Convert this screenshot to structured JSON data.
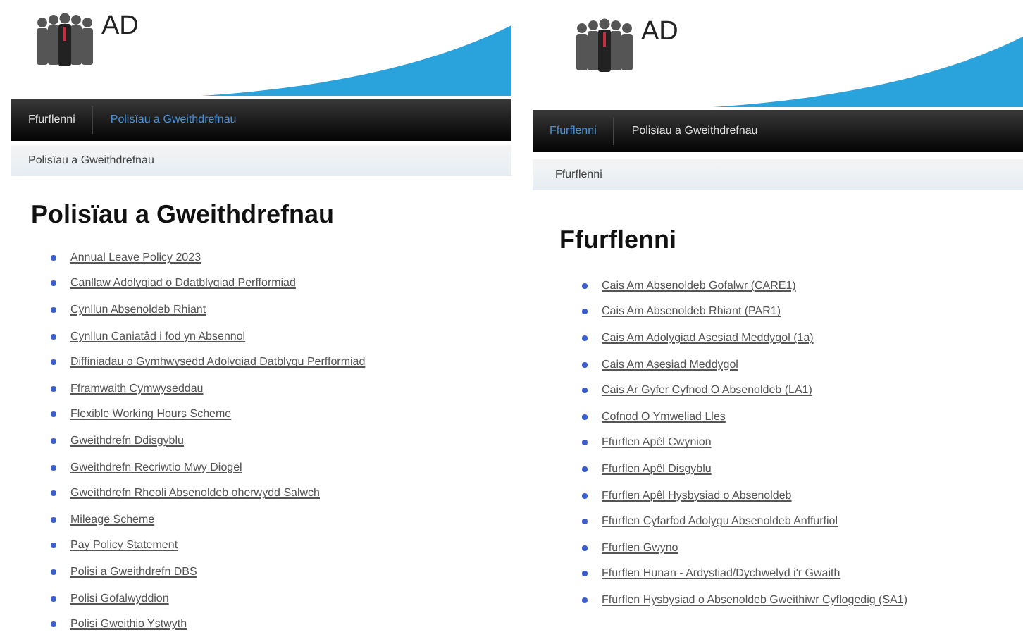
{
  "panels": [
    {
      "logo_text": "AD",
      "nav": [
        {
          "label": "Ffurflenni",
          "selected": false
        },
        {
          "label": "Polisïau a Gweithdrefnau",
          "selected": true
        }
      ],
      "breadcrumb": "Polisïau a Gweithdrefnau",
      "heading": "Polisïau a Gweithdrefnau",
      "links": [
        "Annual Leave Policy 2023",
        "Canllaw Adolygiad o Ddatblygiad Perfformiad",
        "Cynllun Absenoldeb Rhiant",
        "Cynllun Caniatâd i fod yn Absennol",
        "Diffiniadau o Gymhwysedd Adolygiad Datblygu Perfformiad",
        "Fframwaith Cymwyseddau",
        "Flexible Working Hours Scheme",
        "Gweithdrefn Ddisgyblu",
        "Gweithdrefn Recriwtio Mwy Diogel",
        "Gweithdrefn Rheoli Absenoldeb oherwydd Salwch",
        "Mileage Scheme",
        "Pay Policy Statement",
        "Polisi a Gweithdrefn DBS",
        "Polisi Gofalwyddion",
        "Polisi Gweithio Ystwyth"
      ]
    },
    {
      "logo_text": "AD",
      "nav": [
        {
          "label": "Ffurflenni",
          "selected": true
        },
        {
          "label": "Polisïau a Gweithdrefnau",
          "selected": false
        }
      ],
      "breadcrumb": "Ffurflenni",
      "heading": "Ffurflenni",
      "links": [
        "Cais Am Absenoldeb Gofalwr (CARE1)",
        "Cais Am Absenoldeb Rhiant (PAR1)",
        "Cais Am Adolygiad Asesiad Meddygol (1a)",
        "Cais Am Asesiad Meddygol",
        "Cais Ar Gyfer Cyfnod O Absenoldeb (LA1)",
        "Cofnod O Ymweliad Lles",
        "Ffurflen Apêl Cwynion",
        "Ffurflen Apêl Disgyblu",
        "Ffurflen Apêl Hysbysiad o Absenoldeb",
        "Ffurflen Cyfarfod Adolygu Absenoldeb Anffurfiol",
        "Ffurflen Gwyno",
        "Ffurflen Hunan - Ardystiad/Dychwelyd i'r Gwaith",
        "Ffurflen Hysbysiad o Absenoldeb Gweithiwr Cyflogedig (SA1)"
      ]
    }
  ]
}
